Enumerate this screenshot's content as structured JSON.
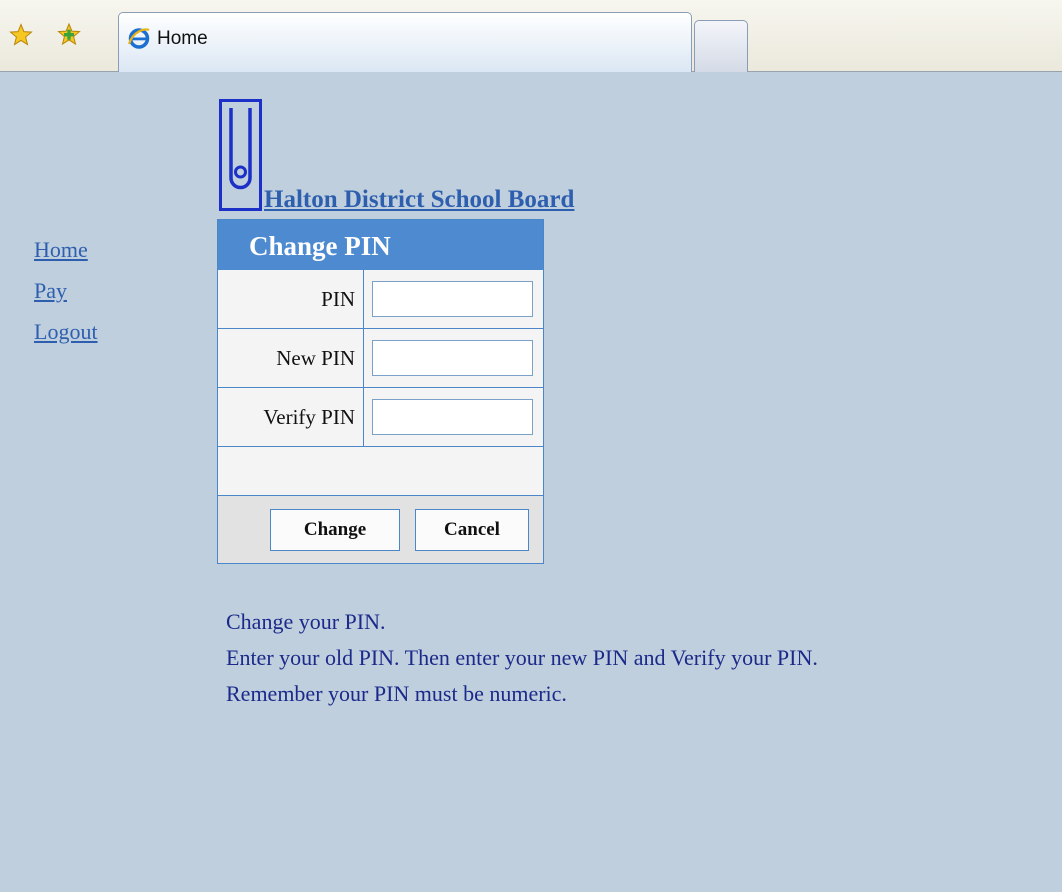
{
  "browser": {
    "tab_title": "Home",
    "icons": [
      "favorites-star-icon",
      "add-favorites-icon",
      "ie-page-icon"
    ]
  },
  "header": {
    "org_name": "Halton District School Board"
  },
  "sidebar": {
    "links": [
      {
        "label": "Home"
      },
      {
        "label": "Pay"
      },
      {
        "label": "Logout"
      }
    ]
  },
  "form": {
    "title": "Change PIN",
    "fields": [
      {
        "label": "PIN",
        "value": ""
      },
      {
        "label": "New PIN",
        "value": ""
      },
      {
        "label": "Verify PIN",
        "value": ""
      }
    ],
    "buttons": {
      "change": "Change",
      "cancel": "Cancel"
    }
  },
  "instructions": [
    "Change your PIN.",
    "Enter your old PIN. Then enter your new PIN and Verify your PIN.",
    "Remember your PIN must be numeric."
  ],
  "colors": {
    "page_background": "#bfcfdd",
    "link": "#2e5fae",
    "panel_header": "#4e8ad0",
    "instruction_text": "#1b2a8a"
  }
}
